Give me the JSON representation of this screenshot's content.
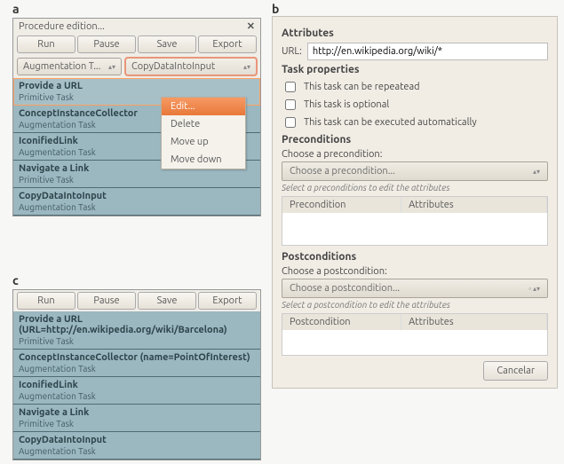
{
  "labels": {
    "a": "a",
    "b": "b",
    "c": "c"
  },
  "panelA": {
    "title": "Procedure edition...",
    "buttons": {
      "run": "Run",
      "pause": "Pause",
      "save": "Save",
      "export": "Export"
    },
    "comboLeft": "Augmentation T...",
    "comboRight": "CopyDataIntoInput",
    "tasks": [
      {
        "title": "Provide a URL",
        "sub": "Primitive Task"
      },
      {
        "title": "ConceptInstanceCollector",
        "sub": "Augmentation Task"
      },
      {
        "title": "IconifiedLink",
        "sub": "Augmentation Task"
      },
      {
        "title": "Navigate a Link",
        "sub": "Primitive Task"
      },
      {
        "title": "CopyDataIntoInput",
        "sub": "Augmentation Task"
      }
    ],
    "context": {
      "edit": "Edit...",
      "delete": "Delete",
      "moveup": "Move up",
      "movedown": "Move down"
    }
  },
  "panelC": {
    "buttons": {
      "run": "Run",
      "pause": "Pause",
      "save": "Save",
      "export": "Export"
    },
    "tasks": [
      {
        "title": "Provide a URL (URL=http://en.wikipedia.org/wiki/Barcelona)",
        "sub": "Primitive Task"
      },
      {
        "title": "ConceptInstanceCollector (name=PointOfInterest)",
        "sub": "Augmentation Task"
      },
      {
        "title": "IconifiedLink",
        "sub": "Augmentation Task"
      },
      {
        "title": "Navigate a Link",
        "sub": "Primitive Task"
      },
      {
        "title": "CopyDataIntoInput",
        "sub": "Augmentation Task"
      }
    ]
  },
  "panelB": {
    "attributesHeader": "Attributes",
    "urlLabel": "URL:",
    "urlValue": "http://en.wikipedia.org/wiki/*",
    "taskPropsHeader": "Task properties",
    "chk1": "This task can be repeatead",
    "chk2": "This task is optional",
    "chk3": "This task can be executed automatically",
    "preHeader": "Preconditions",
    "preChoose": "Choose a precondition:",
    "preDrop": "Choose a precondition...",
    "preHint": "Select a preconditions to edit the attributes",
    "preCol1": "Precondition",
    "preCol2": "Attributes",
    "postHeader": "Postconditions",
    "postChoose": "Choose a postcondition:",
    "postDrop": "Choose a postcondition...",
    "postHint": "Select a postcondition to edit the attributes",
    "postCol1": "Postcondition",
    "postCol2": "Attributes",
    "cancel": "Cancelar"
  }
}
